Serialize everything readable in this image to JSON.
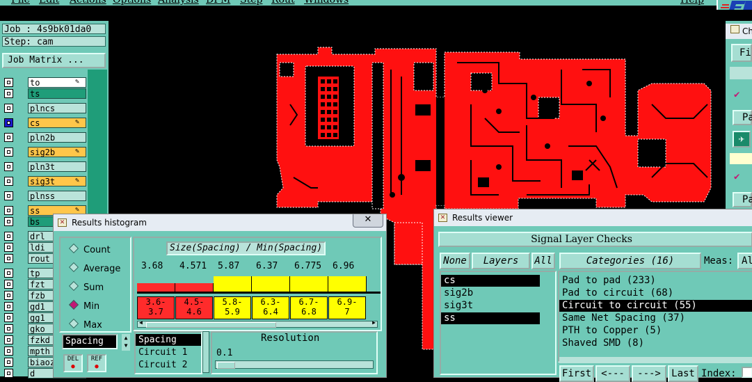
{
  "menubar": {
    "items": [
      "File",
      "Edit",
      "Actions",
      "Options",
      "Analysis",
      "DFM",
      "Step",
      "Rout",
      "Windows"
    ],
    "help": "Help"
  },
  "job": {
    "job_label": "Job : 4s9bk01da0",
    "step_label": "Step: cam",
    "job_matrix_button": "Job Matrix ..."
  },
  "layers": [
    {
      "name": "to",
      "style": "white",
      "checked": false,
      "icon": "pencil-icon"
    },
    {
      "name": "ts",
      "style": "green",
      "checked": false,
      "icon": ""
    },
    {
      "name": "plncs",
      "style": "plain",
      "checked": false,
      "icon": ""
    },
    {
      "name": "cs",
      "style": "yellow",
      "checked": true,
      "icon": "pencil-grid-icon"
    },
    {
      "name": "pln2b",
      "style": "plain",
      "checked": false,
      "icon": ""
    },
    {
      "name": "sig2b",
      "style": "yellow",
      "checked": false,
      "icon": "pencil-icon"
    },
    {
      "name": "pln3t",
      "style": "plain",
      "checked": false,
      "icon": ""
    },
    {
      "name": "sig3t",
      "style": "yellow",
      "checked": false,
      "icon": "pencil-icon"
    },
    {
      "name": "plnss",
      "style": "plain",
      "checked": false,
      "icon": ""
    },
    {
      "name": "ss",
      "style": "yellow",
      "checked": false,
      "icon": "pencil-icon"
    },
    {
      "name": "bs",
      "style": "green",
      "checked": false,
      "icon": ""
    },
    {
      "name": "drl",
      "style": "plain",
      "checked": false,
      "icon": ""
    },
    {
      "name": "ldi",
      "style": "plain",
      "checked": false,
      "icon": ""
    },
    {
      "name": "rout",
      "style": "plain",
      "checked": false,
      "icon": ""
    },
    {
      "name": "tp",
      "style": "plain",
      "checked": false,
      "icon": ""
    },
    {
      "name": "fzt",
      "style": "plain",
      "checked": false,
      "icon": ""
    },
    {
      "name": "fzb",
      "style": "plain",
      "checked": false,
      "icon": ""
    },
    {
      "name": "gd1",
      "style": "plain",
      "checked": false,
      "icon": ""
    },
    {
      "name": "gg1",
      "style": "plain",
      "checked": false,
      "icon": ""
    },
    {
      "name": "gko",
      "style": "plain",
      "checked": false,
      "icon": ""
    },
    {
      "name": "fzkd",
      "style": "plain",
      "checked": false,
      "icon": ""
    },
    {
      "name": "mpth",
      "style": "plain",
      "checked": false,
      "icon": ""
    },
    {
      "name": "biaoz",
      "style": "plain",
      "checked": false,
      "icon": ""
    },
    {
      "name": "d",
      "style": "plain",
      "checked": false,
      "icon": ""
    }
  ],
  "histogram": {
    "window_title": "Results histogram",
    "close": "✕",
    "modes": [
      {
        "label": "Count",
        "selected": false
      },
      {
        "label": "Average",
        "selected": false
      },
      {
        "label": "Sum",
        "selected": false
      },
      {
        "label": "Min",
        "selected": true
      },
      {
        "label": "Max",
        "selected": false
      }
    ],
    "chart_title": "Size(Spacing) / Min(Spacing)",
    "bars": [
      {
        "value": "3.68",
        "range": "3.6-\n3.7",
        "color": "#ff2b2b"
      },
      {
        "value": "4.571",
        "range": "4.5-\n4.6",
        "color": "#ff2b2b"
      },
      {
        "value": "5.87",
        "range": "5.8-\n5.9",
        "color": "#ffff00"
      },
      {
        "value": "6.37",
        "range": "6.3-\n6.4",
        "color": "#ffff00"
      },
      {
        "value": "6.775",
        "range": "6.7-\n6.8",
        "color": "#ffff00"
      },
      {
        "value": "6.96",
        "range": "6.9-\n7",
        "color": "#ffff00"
      }
    ],
    "spacing_field": "Spacing",
    "metric_list": [
      "Spacing",
      "Circuit 1",
      "Circuit 2"
    ],
    "resolution_label": "Resolution",
    "resolution_value": "0.1",
    "del_button": "DEL",
    "ref_button": "REF"
  },
  "results_viewer": {
    "window_title": "Results viewer",
    "header": "Signal Layer Checks",
    "none_button": "None",
    "layers_button": "Layers",
    "all_button": "All",
    "layers": [
      {
        "name": "cs",
        "selected": true
      },
      {
        "name": "sig2b",
        "selected": false
      },
      {
        "name": "sig3t",
        "selected": false
      },
      {
        "name": "ss",
        "selected": true
      }
    ],
    "categories_button": "Categories (16)",
    "meas_label": "Meas:",
    "meas_value": "Al",
    "categories": [
      {
        "label": "Pad to pad (233)",
        "selected": false
      },
      {
        "label": "Pad to circuit (68)",
        "selected": false
      },
      {
        "label": "Circuit to circuit (55)",
        "selected": true
      },
      {
        "label": "Same Net Spacing (37)",
        "selected": false
      },
      {
        "label": "PTH to Copper (5)",
        "selected": false
      },
      {
        "label": "Shaved SMD (8)",
        "selected": false
      }
    ],
    "nav": [
      "First",
      "<---",
      "--->",
      "Last"
    ],
    "index_label": "Index:"
  },
  "right_panel": {
    "title_fragment": "Ch",
    "file_fragment": "Fil",
    "pa1": "Pa",
    "pa2": "Pa"
  }
}
